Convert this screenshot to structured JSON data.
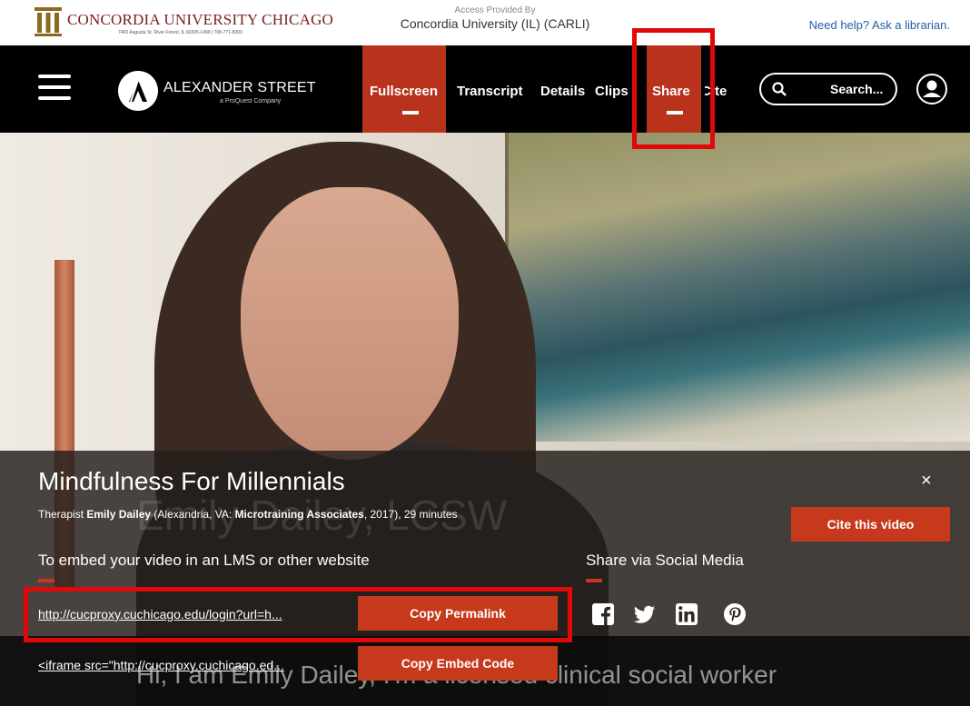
{
  "institution": {
    "name": "CONCORDIA UNIVERSITY CHICAGO",
    "address": "7400 Augusta St. River Forest, IL 60305-1499 | 708-771-8300",
    "access_label": "Access Provided By",
    "access_org": "Concordia University (IL) (CARLI)",
    "help_link": "Need help? Ask a librarian."
  },
  "brand": {
    "name": "ALEXANDER STREET",
    "sub": "a ProQuest Company"
  },
  "nav": {
    "fullscreen": "Fullscreen",
    "transcript": "Transcript",
    "details": "Details",
    "clips": "Clips",
    "share": "Share",
    "cite": "Cite"
  },
  "search": {
    "placeholder": "Search..."
  },
  "video": {
    "title": "Mindfulness For Millennials",
    "meta_prefix": "Therapist ",
    "meta_person": "Emily Dailey",
    "meta_mid": " (Alexandria, VA: ",
    "meta_publisher": "Microtraining Associates",
    "meta_suffix": ", 2017), 29 minutes",
    "background_name": "Emily Dailey, LCSW",
    "caption": "Hi, I am Emily Dailey, I'm a licensed clinical social worker"
  },
  "share_panel": {
    "close": "×",
    "cite_button": "Cite this video",
    "embed_heading": "To embed your video in an LMS or other website",
    "social_heading": "Share via Social Media",
    "permalink": "http://cucproxy.cuchicago.edu/login?url=h...",
    "permalink_button": "Copy Permalink",
    "embed_code": "<iframe src=\"http://cucproxy.cuchicago.ed...",
    "embed_button": "Copy Embed Code"
  },
  "social_icons": [
    "facebook-icon",
    "twitter-icon",
    "linkedin-icon",
    "pinterest-icon"
  ],
  "colors": {
    "accent": "#c7391c",
    "nav_bg": "#000000",
    "highlight": "#e1080a",
    "link_blue": "#1f5fa8"
  }
}
